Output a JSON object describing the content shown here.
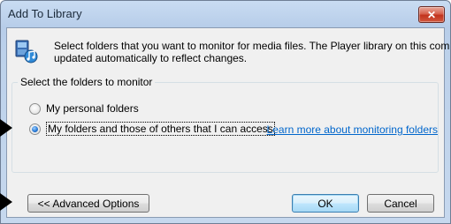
{
  "window": {
    "title": "Add To Library",
    "close_label": "✕"
  },
  "description": {
    "line1": "Select folders that you want to monitor for media files. The Player library on this computer is",
    "line2": "updated automatically to reflect changes."
  },
  "group": {
    "legend": "Select the folders to monitor",
    "options": [
      {
        "label": "My personal folders",
        "selected": false
      },
      {
        "label": "My folders and those of others that I can access",
        "selected": true
      }
    ]
  },
  "link": {
    "text": "Learn more about monitoring folders"
  },
  "buttons": {
    "advanced": "<< Advanced Options",
    "ok": "OK",
    "cancel": "Cancel"
  },
  "colors": {
    "link": "#0066cc",
    "titlebar": "#b7cde9",
    "close_button": "#c2331d"
  }
}
